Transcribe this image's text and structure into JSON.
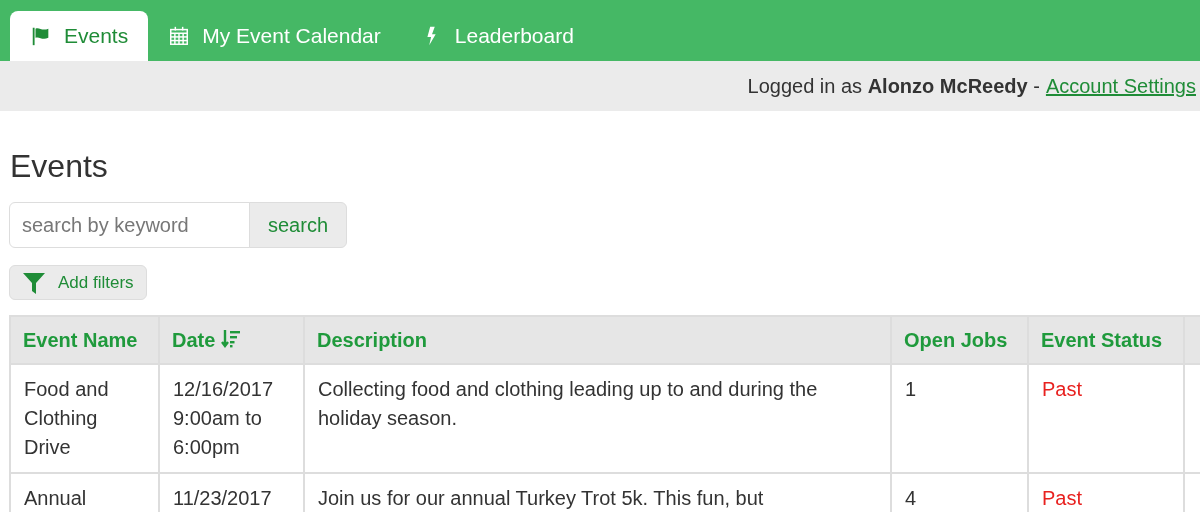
{
  "tabs": [
    {
      "label": "Events",
      "kind": "flag",
      "selected": true
    },
    {
      "label": "My Event Calendar",
      "kind": "calendar",
      "selected": false
    },
    {
      "label": "Leaderboard",
      "kind": "bolt",
      "selected": false
    }
  ],
  "account_bar": {
    "prefix": "Logged in as",
    "user": "Alonzo McReedy",
    "separator": "-",
    "link": "Account Settings"
  },
  "heading": "Events",
  "search": {
    "placeholder": "search by keyword",
    "button": "search"
  },
  "filters_button": "Add filters",
  "table": {
    "columns": [
      {
        "label": "Event Name",
        "sorted": false
      },
      {
        "label": "Date",
        "sorted": true
      },
      {
        "label": "Description",
        "sorted": false
      },
      {
        "label": "Open Jobs",
        "sorted": false
      },
      {
        "label": "Event Status",
        "sorted": false
      }
    ],
    "rows": [
      {
        "name": "Food and Clothing Drive",
        "date": [
          "12/16/2017",
          "9:00am to 6:00pm"
        ],
        "description": "Collecting food and clothing leading up to and during the holiday season.",
        "open_jobs": "1",
        "status": {
          "text": "Past",
          "kind": "past"
        }
      },
      {
        "name": "Annual",
        "date": [
          "11/23/2017"
        ],
        "description": "Join us for our annual Turkey Trot 5k. This fun, but",
        "open_jobs": "4",
        "status": {
          "text": "Past",
          "kind": "past"
        }
      }
    ]
  }
}
